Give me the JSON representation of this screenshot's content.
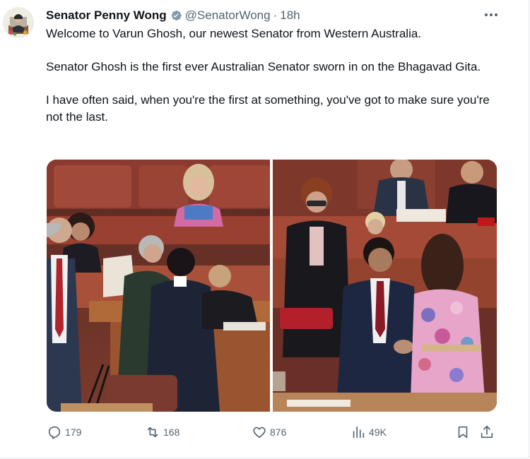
{
  "tweet": {
    "author": {
      "name": "Senator Penny Wong",
      "handle": "@SenatorWong",
      "separator": "·",
      "age": "18h",
      "verified": true
    },
    "paragraphs": [
      "Welcome to Varun Ghosh, our newest Senator from Western Australia.",
      "Senator Ghosh is the first ever Australian Senator sworn in on the Bhagavad Gita.",
      "I have often said, when you're the first at something, you've got to make sure you're not the last."
    ],
    "media": {
      "count": 2
    },
    "actions": {
      "replies": "179",
      "retweets": "168",
      "likes": "876",
      "views": "49K"
    }
  },
  "icons": {
    "verified": "verified-badge-icon",
    "more": "more-dots-icon",
    "reply": "reply-icon",
    "retweet": "retweet-icon",
    "like": "heart-icon",
    "views": "views-bar-chart-icon",
    "bookmark": "bookmark-icon",
    "share": "share-icon"
  },
  "colors": {
    "text_primary": "#0f1419",
    "text_secondary": "#536471",
    "verified_badge": "#829aab"
  }
}
